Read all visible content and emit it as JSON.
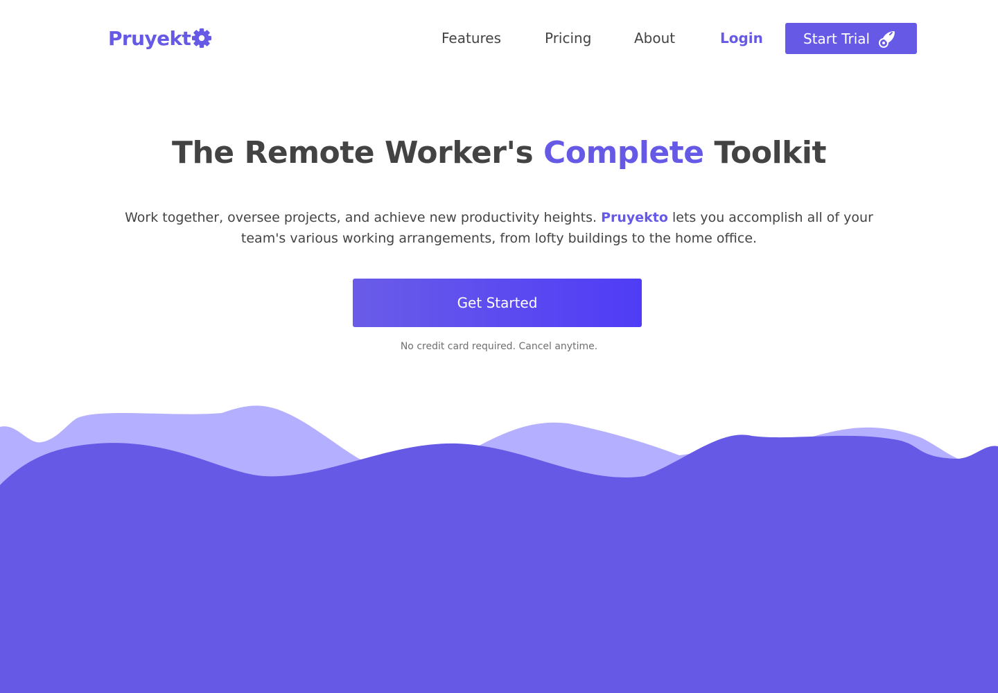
{
  "nav": {
    "logo_text": "Pruyekt",
    "links": [
      {
        "label": "Features"
      },
      {
        "label": "Pricing"
      },
      {
        "label": "About"
      }
    ],
    "login_label": "Login",
    "trial_label": "Start Trial",
    "logo_icon": "gear-icon",
    "trial_icon": "rocket-icon"
  },
  "hero": {
    "title_before": "The Remote Worker's ",
    "title_accent": "Complete",
    "title_after": " Toolkit",
    "subtitle_before": "Work together, oversee projects, and achieve new productivity heights. ",
    "subtitle_brand": "Pruyekto",
    "subtitle_after": " lets you accomplish all of your team's various working arrangements, from lofty buildings to the home office.",
    "cta_label": "Get Started",
    "note": "No credit card required. Cancel anytime."
  },
  "colors": {
    "brand": "#6659e6",
    "wave_back": "#b5afff",
    "wave_front": "#6659e6",
    "text": "#434343"
  }
}
